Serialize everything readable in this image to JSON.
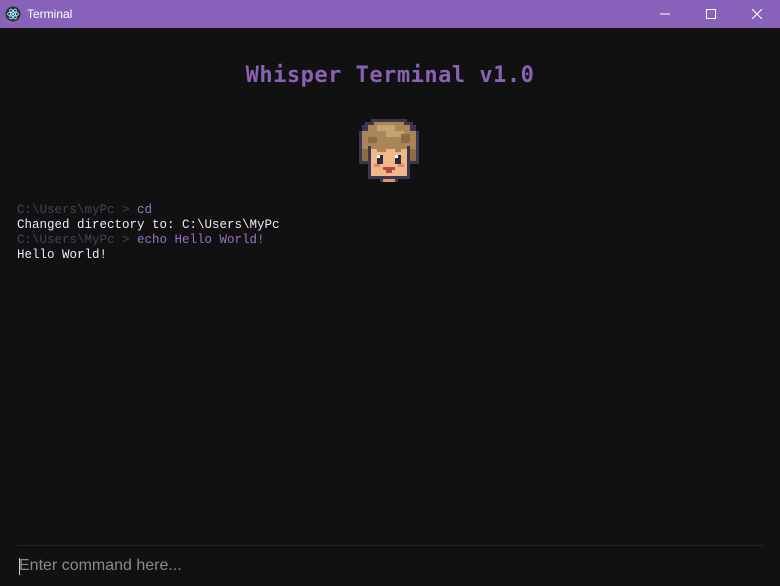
{
  "window": {
    "title": "Terminal",
    "accent_color": "#8862b8",
    "background_color": "#121112",
    "controls": [
      {
        "name": "minimize-button",
        "icon": "minimize-icon"
      },
      {
        "name": "maximize-button",
        "icon": "maximize-icon"
      },
      {
        "name": "close-button",
        "icon": "close-icon"
      }
    ]
  },
  "app_icon": "electron-atom-icon",
  "heading": "Whisper Terminal v1.0",
  "avatar": "pixel-art-boy-avatar",
  "log": [
    {
      "type": "command",
      "prompt": "C:\\Users\\myPc >",
      "command": " cd"
    },
    {
      "type": "output",
      "text": "Changed directory to: C:\\Users\\MyPc"
    },
    {
      "type": "command",
      "prompt": "C:\\Users\\MyPc >",
      "command": " echo Hello World!"
    },
    {
      "type": "output",
      "text": "Hello World!"
    }
  ],
  "input": {
    "placeholder": "Enter command here...",
    "value": ""
  }
}
